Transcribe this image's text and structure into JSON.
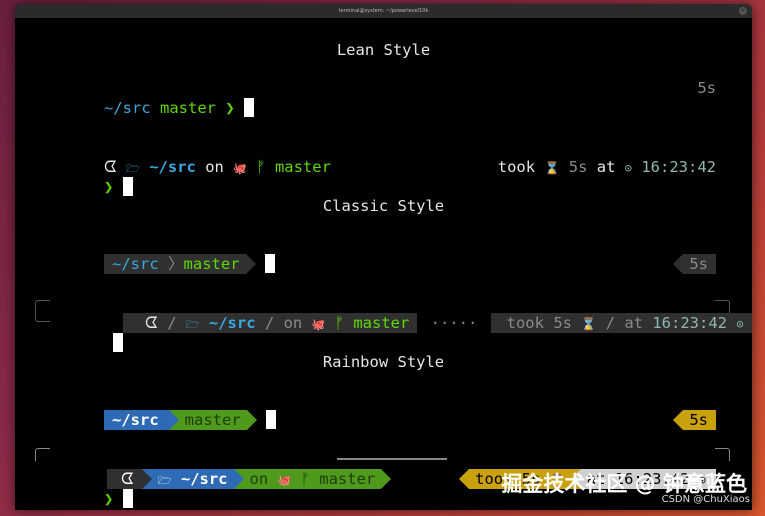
{
  "window": {
    "title": "terminal@system: ~/powerlevel10k"
  },
  "sections": {
    "lean": "Lean Style",
    "classic": "Classic Style",
    "rainbow": "Rainbow Style"
  },
  "lean1": {
    "path": "~/src",
    "branch": "master",
    "prompt": "❯",
    "duration": "5s"
  },
  "lean2": {
    "os_icon": "ᗧ",
    "folder_icon": "🗁",
    "path": "~/src",
    "on": "on",
    "git_icon": "🐙",
    "branch_icon": "ᚠ",
    "branch": "master",
    "took": "took",
    "hourglass": "⌛",
    "duration": "5s",
    "at": "at",
    "clock_icon": "⊙",
    "time": "16:23:42",
    "prompt": "❯"
  },
  "classic1": {
    "path": "~/src",
    "branch": "master",
    "duration": "5s"
  },
  "classic2": {
    "os_icon": "ᗧ",
    "folder_icon": "🗁",
    "path": "~/src",
    "on": "on",
    "git_icon": "🐙",
    "branch_icon": "ᚠ",
    "branch": "master",
    "took": "took",
    "duration": "5s",
    "hourglass": "⌛",
    "at": "at",
    "time": "16:23:42",
    "clock_icon": "⊙"
  },
  "rainbow1": {
    "path": "~/src",
    "branch": "master",
    "duration": "5s"
  },
  "rainbow2": {
    "os_icon": "ᗧ",
    "folder_icon": "🗁",
    "path": "~/src",
    "on": "on",
    "git_icon": "🐙",
    "branch_icon": "ᚠ",
    "branch": "master",
    "took": "took",
    "duration": "5s",
    "hourglass": "⌛",
    "at": "at",
    "time": "16:23:42",
    "clock_icon": "⊙",
    "prompt": "❯"
  },
  "watermark": {
    "main": "掘金技术社区 @ 钟意蓝色",
    "sub": "CSDN @ChuXiaos"
  },
  "colors": {
    "classic_bg": "#303030",
    "rainbow_blue": "#2f6ab5",
    "rainbow_green": "#4f9a1c",
    "rainbow_yellow": "#c9a10c",
    "rainbow_light": "#d0d0d0"
  }
}
